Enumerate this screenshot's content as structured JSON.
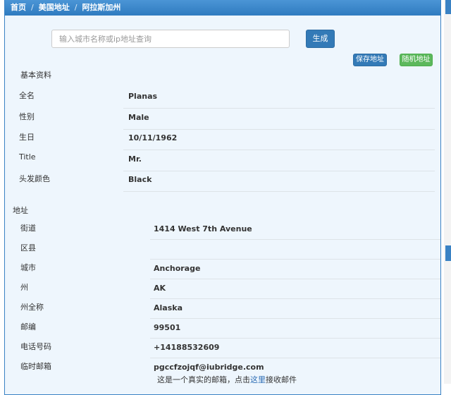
{
  "breadcrumb": {
    "home": "首页",
    "country": "美国地址",
    "state": "阿拉斯加州"
  },
  "search": {
    "placeholder": "输入城市名称或ip地址查询",
    "value": ""
  },
  "buttons": {
    "generate": "生成",
    "save": "保存地址",
    "random": "随机地址"
  },
  "basic": {
    "title": "基本资料",
    "rows": [
      {
        "label": "全名",
        "value": "Planas"
      },
      {
        "label": "性别",
        "value": "Male"
      },
      {
        "label": "生日",
        "value": "10/11/1962"
      },
      {
        "label": "Title",
        "value": "Mr."
      },
      {
        "label": "头发颜色",
        "value": "Black"
      }
    ]
  },
  "address": {
    "title": "地址",
    "rows": [
      {
        "label": "街道",
        "value": "1414 West 7th Avenue"
      },
      {
        "label": "区县",
        "value": ""
      },
      {
        "label": "城市",
        "value": "Anchorage"
      },
      {
        "label": "州",
        "value": "AK"
      },
      {
        "label": "州全称",
        "value": "Alaska"
      },
      {
        "label": "邮编",
        "value": "99501"
      },
      {
        "label": "电话号码",
        "value": "+14188532609"
      },
      {
        "label": "临时邮箱",
        "value": "pgccfzojqf@iubridge.com"
      }
    ],
    "email_note_prefix": "这是一个真实的邮箱，点击",
    "email_note_link": "这里",
    "email_note_suffix": "接收邮件"
  },
  "colors": {
    "primary": "#337ab7",
    "success": "#5cb85c",
    "panel_bg": "#eef6fd",
    "header": "#3a82c4"
  }
}
